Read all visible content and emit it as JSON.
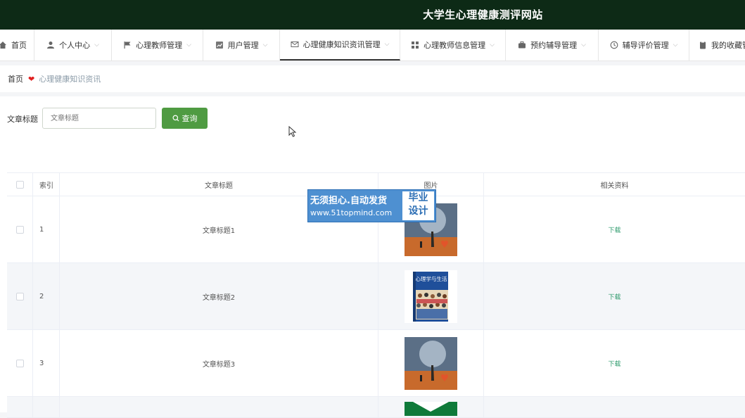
{
  "site": {
    "title": "大学生心理健康测评网站"
  },
  "nav": {
    "items": [
      {
        "label": "首页",
        "icon": "home-icon"
      },
      {
        "label": "个人中心",
        "icon": "user-icon"
      },
      {
        "label": "心理教师管理",
        "icon": "flag-icon"
      },
      {
        "label": "用户管理",
        "icon": "chart-icon"
      },
      {
        "label": "心理健康知识资讯管理",
        "icon": "mail-icon"
      },
      {
        "label": "心理教师信息管理",
        "icon": "grid-icon"
      },
      {
        "label": "预约辅导管理",
        "icon": "briefcase-icon"
      },
      {
        "label": "辅导评价管理",
        "icon": "clock-icon"
      },
      {
        "label": "我的收藏管理",
        "icon": "clipboard-icon"
      }
    ]
  },
  "breadcrumb": {
    "home": "首页",
    "current": "心理健康知识资讯"
  },
  "search": {
    "label": "文章标题",
    "placeholder": "文章标题",
    "button": "查询"
  },
  "table": {
    "headers": {
      "index": "索引",
      "title": "文章标题",
      "image": "图片",
      "resource": "相关资料"
    },
    "rows": [
      {
        "index": "1",
        "title": "文章标题1",
        "image": "tree-heart-image",
        "resource": "下载"
      },
      {
        "index": "2",
        "title": "文章标题2",
        "image": "book-cover-image",
        "book_text": "心理学与生活",
        "resource": "下载"
      },
      {
        "index": "3",
        "title": "文章标题3",
        "image": "tree-heart-image",
        "resource": "下载"
      }
    ]
  },
  "watermark": {
    "line1": "无须担心.自动发货",
    "line2": "www.51topmind.com",
    "badge1": "毕业",
    "badge2": "设计"
  },
  "colors": {
    "topbar": "#0d2a16",
    "accent": "#4f9b42",
    "link": "#2f9b6d",
    "heart": "#e02020"
  }
}
